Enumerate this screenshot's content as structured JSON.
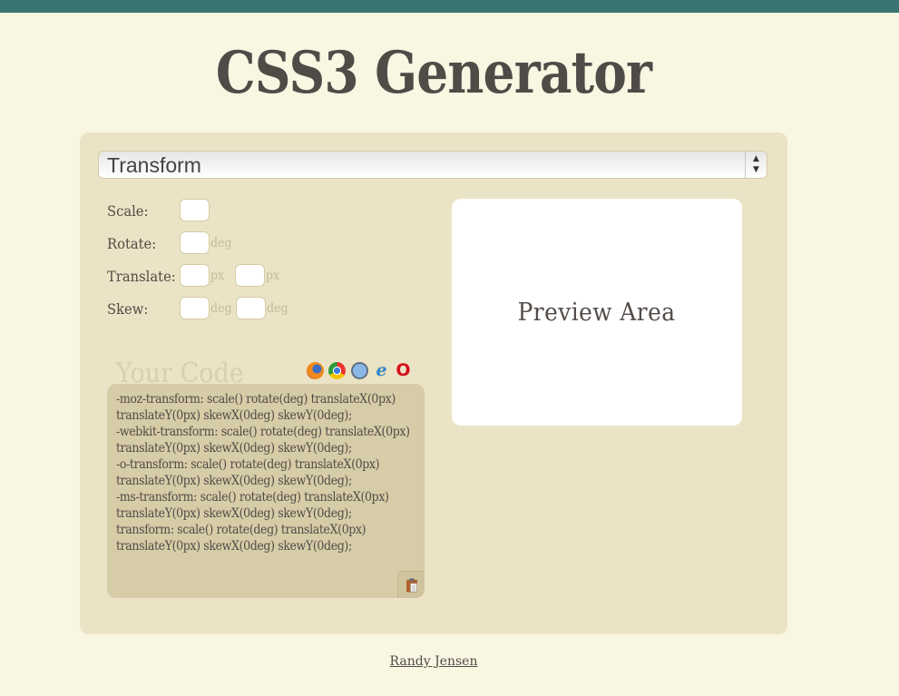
{
  "header": {
    "title": "CSS3 Generator"
  },
  "generator_select": {
    "selected": "Transform"
  },
  "form": {
    "scale": {
      "label": "Scale:",
      "value": ""
    },
    "rotate": {
      "label": "Rotate:",
      "value": "",
      "unit": "deg"
    },
    "translate": {
      "label": "Translate:",
      "x_value": "",
      "y_value": "",
      "x_unit": "px",
      "y_unit": "px"
    },
    "skew": {
      "label": "Skew:",
      "x_value": "",
      "y_value": "",
      "x_unit": "deg",
      "y_unit": "deg"
    }
  },
  "preview": {
    "label": "Preview Area"
  },
  "code": {
    "title": "Your Code",
    "browsers": [
      "firefox-icon",
      "chrome-icon",
      "safari-icon",
      "internet-explorer-icon",
      "opera-icon"
    ],
    "text": "-moz-transform: scale() rotate(deg) translateX(0px) translateY(0px) skewX(0deg) skewY(0deg);\n-webkit-transform: scale() rotate(deg) translateX(0px) translateY(0px) skewX(0deg) skewY(0deg);\n-o-transform: scale() rotate(deg) translateX(0px) translateY(0px) skewX(0deg) skewY(0deg);\n-ms-transform: scale() rotate(deg) translateX(0px) translateY(0px) skewX(0deg) skewY(0deg);\ntransform: scale() rotate(deg) translateX(0px) translateY(0px) skewX(0deg) skewY(0deg);",
    "copy_icon": "clipboard-icon"
  },
  "footer": {
    "author_link": "Randy Jensen"
  },
  "colors": {
    "topbar": "#387573",
    "background": "#f9f6e2",
    "panel": "#ebe3c5",
    "codebox": "#d6cca7",
    "text": "#524b47"
  }
}
